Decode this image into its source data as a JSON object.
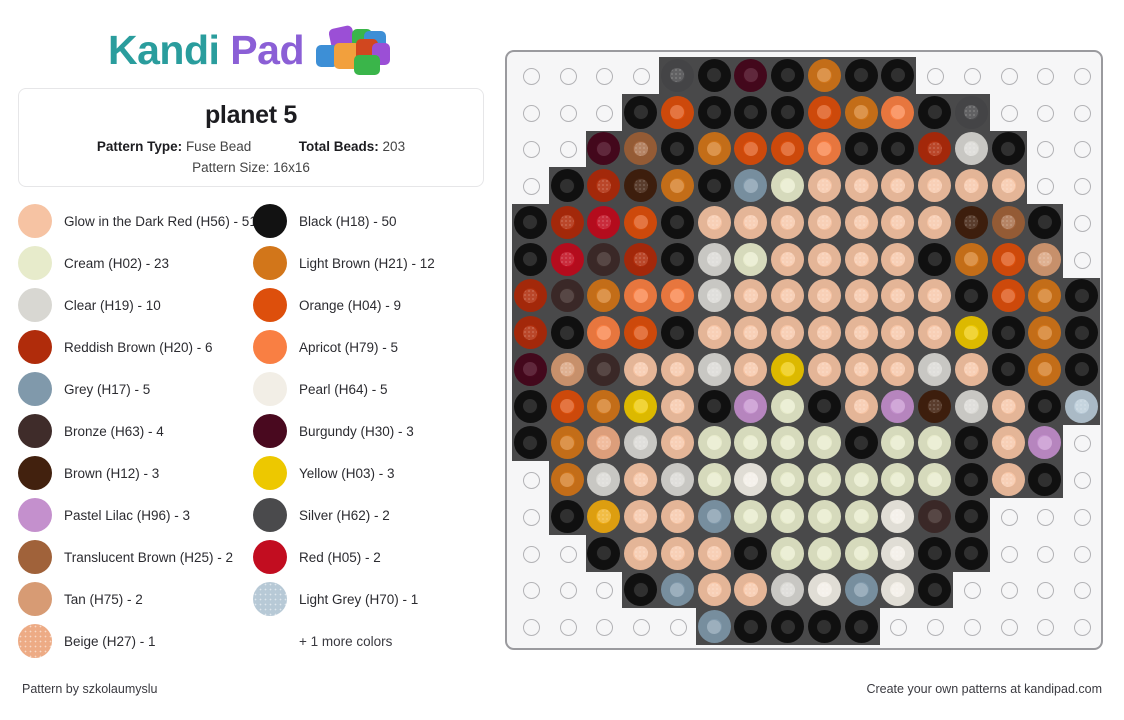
{
  "brand": {
    "name_part1": "Kandi",
    "name_part2": "Pad",
    "logo_icon": "kandi-beads-logo",
    "color_teal": "#2a9d9d",
    "color_purple": "#8b5fd6"
  },
  "info": {
    "title": "planet 5",
    "pattern_type_label": "Pattern Type:",
    "pattern_type_value": "Fuse Bead",
    "total_beads_label": "Total Beads:",
    "total_beads_value": "203",
    "pattern_size_label": "Pattern Size:",
    "pattern_size_value": "16x16"
  },
  "legend": {
    "more_colors": "+ 1 more colors",
    "left_column": [
      {
        "label": "Glow in the Dark Red (H56) - 51",
        "color": "#f6c3a3",
        "name": "Glow in the Dark Red",
        "code": "H56",
        "count": 51,
        "texture": "plain"
      },
      {
        "label": "Cream (H02) - 23",
        "color": "#e7ebcb",
        "name": "Cream",
        "code": "H02",
        "count": 23,
        "texture": "plain"
      },
      {
        "label": "Clear (H19) - 10",
        "color": "#d8d7d2",
        "name": "Clear",
        "code": "H19",
        "count": 10,
        "texture": "plain"
      },
      {
        "label": "Reddish Brown (H20) - 6",
        "color": "#b02c0b",
        "name": "Reddish Brown",
        "code": "H20",
        "count": 6,
        "texture": "plain"
      },
      {
        "label": "Grey (H17) - 5",
        "color": "#8099ab",
        "name": "Grey",
        "code": "H17",
        "count": 5,
        "texture": "plain"
      },
      {
        "label": "Bronze (H63) - 4",
        "color": "#3f2c2a",
        "name": "Bronze",
        "code": "H63",
        "count": 4,
        "texture": "plain"
      },
      {
        "label": "Brown (H12) - 3",
        "color": "#42210e",
        "name": "Brown",
        "code": "H12",
        "count": 3,
        "texture": "plain"
      },
      {
        "label": "Pastel Lilac (H96) - 3",
        "color": "#c490cd",
        "name": "Pastel Lilac",
        "code": "H96",
        "count": 3,
        "texture": "plain"
      },
      {
        "label": "Translucent Brown (H25) - 2",
        "color": "#a0623a",
        "name": "Translucent Brown",
        "code": "H25",
        "count": 2,
        "texture": "plain"
      },
      {
        "label": "Tan (H75) - 2",
        "color": "#d79b74",
        "name": "Tan",
        "code": "H75",
        "count": 2,
        "texture": "plain"
      },
      {
        "label": "Beige (H27) - 1",
        "color": "#edab85",
        "name": "Beige",
        "code": "H27",
        "count": 1,
        "texture": "dotted"
      }
    ],
    "right_column": [
      {
        "label": "Black (H18) - 50",
        "color": "#121212",
        "name": "Black",
        "code": "H18",
        "count": 50,
        "texture": "plain"
      },
      {
        "label": "Light Brown (H21) - 12",
        "color": "#d2761a",
        "name": "Light Brown",
        "code": "H21",
        "count": 12,
        "texture": "plain"
      },
      {
        "label": "Orange (H04) - 9",
        "color": "#dd4f0c",
        "name": "Orange",
        "code": "H04",
        "count": 9,
        "texture": "plain"
      },
      {
        "label": "Apricot (H79) - 5",
        "color": "#f97f43",
        "name": "Apricot",
        "code": "H79",
        "count": 5,
        "texture": "plain"
      },
      {
        "label": "Pearl (H64) - 5",
        "color": "#f2eee6",
        "name": "Pearl",
        "code": "H64",
        "count": 5,
        "texture": "plain"
      },
      {
        "label": "Burgundy (H30) - 3",
        "color": "#49091f",
        "name": "Burgundy",
        "code": "H30",
        "count": 3,
        "texture": "plain"
      },
      {
        "label": "Yellow (H03) - 3",
        "color": "#edc800",
        "name": "Yellow",
        "code": "H03",
        "count": 3,
        "texture": "plain"
      },
      {
        "label": "Silver (H62) - 2",
        "color": "#4a4a4c",
        "name": "Silver",
        "code": "H62",
        "count": 2,
        "texture": "plain"
      },
      {
        "label": "Red (H05) - 2",
        "color": "#c20d20",
        "name": "Red",
        "code": "H05",
        "count": 2,
        "texture": "plain"
      },
      {
        "label": "Light Grey (H70) - 1",
        "color": "#b7c9d6",
        "name": "Light Grey",
        "code": "H70",
        "count": 1,
        "texture": "dotted"
      }
    ]
  },
  "palette": {
    "E": {
      "name": "empty",
      "color": null
    },
    "G": {
      "name": "Glow in the Dark Red",
      "color": "#f6c3a3",
      "texture": "dot",
      "dark": false
    },
    "K": {
      "name": "Black",
      "color": "#121212",
      "texture": "plain",
      "dark": true
    },
    "C": {
      "name": "Cream",
      "color": "#e7ebcb",
      "texture": "plain",
      "dark": false
    },
    "L": {
      "name": "Clear",
      "color": "#d8d7d2",
      "texture": "dot",
      "dark": false
    },
    "R": {
      "name": "Reddish Brown",
      "color": "#b02c0b",
      "texture": "dot",
      "dark": true
    },
    "Y": {
      "name": "Grey",
      "color": "#8099ab",
      "texture": "plain",
      "dark": false
    },
    "Z": {
      "name": "Bronze",
      "color": "#3f2c2a",
      "texture": "plain",
      "dark": true
    },
    "W": {
      "name": "Brown",
      "color": "#42210e",
      "texture": "dot",
      "dark": true
    },
    "P": {
      "name": "Pastel Lilac",
      "color": "#c490cd",
      "texture": "plain",
      "dark": false
    },
    "T": {
      "name": "Translucent Brown",
      "color": "#a0623a",
      "texture": "dot",
      "dark": false
    },
    "N": {
      "name": "Tan",
      "color": "#d79b74",
      "texture": "dot",
      "dark": false
    },
    "B": {
      "name": "Beige",
      "color": "#edab85",
      "texture": "dot",
      "dark": false
    },
    "O": {
      "name": "Light Brown",
      "color": "#d2761a",
      "texture": "plain",
      "dark": false
    },
    "Q": {
      "name": "Orange",
      "color": "#dd4f0c",
      "texture": "plain",
      "dark": false
    },
    "A": {
      "name": "Apricot",
      "color": "#f97f43",
      "texture": "plain",
      "dark": false
    },
    "X": {
      "name": "Pearl",
      "color": "#f2eee6",
      "texture": "dot",
      "dark": false
    },
    "U": {
      "name": "Burgundy",
      "color": "#49091f",
      "texture": "plain",
      "dark": true
    },
    "J": {
      "name": "Yellow",
      "color": "#edc800",
      "texture": "plain",
      "dark": false
    },
    "S": {
      "name": "Silver",
      "color": "#4a4a4c",
      "texture": "dot",
      "dark": true
    },
    "D": {
      "name": "Red",
      "color": "#c20d20",
      "texture": "dot",
      "dark": true
    },
    "H": {
      "name": "Light Grey",
      "color": "#b7c9d6",
      "texture": "dot",
      "dark": false
    },
    "M": {
      "name": "Marigold",
      "color": "#eeab12",
      "texture": "dot",
      "dark": false
    }
  },
  "grid": {
    "rows": 16,
    "cols": 16,
    "cells": [
      [
        "E",
        "E",
        "E",
        "E",
        "S",
        "K",
        "U",
        "K",
        "O",
        "K",
        "K",
        "E",
        "E",
        "E",
        "E",
        "E"
      ],
      [
        "E",
        "E",
        "E",
        "K",
        "Q",
        "K",
        "K",
        "K",
        "Q",
        "O",
        "A",
        "K",
        "S",
        "E",
        "E",
        "E"
      ],
      [
        "E",
        "E",
        "U",
        "T",
        "K",
        "O",
        "Q",
        "Q",
        "A",
        "K",
        "K",
        "R",
        "L",
        "K",
        "E",
        "E"
      ],
      [
        "E",
        "K",
        "R",
        "W",
        "O",
        "K",
        "Y",
        "C",
        "G",
        "G",
        "G",
        "G",
        "G",
        "G",
        "E",
        "E"
      ],
      [
        "K",
        "R",
        "D",
        "Q",
        "K",
        "G",
        "G",
        "G",
        "G",
        "G",
        "G",
        "G",
        "W",
        "T",
        "K",
        "E"
      ],
      [
        "K",
        "D",
        "Z",
        "R",
        "K",
        "L",
        "C",
        "G",
        "G",
        "G",
        "G",
        "K",
        "O",
        "Q",
        "N",
        "E"
      ],
      [
        "R",
        "Z",
        "O",
        "A",
        "A",
        "L",
        "G",
        "G",
        "G",
        "G",
        "G",
        "G",
        "K",
        "Q",
        "O",
        "K"
      ],
      [
        "R",
        "K",
        "A",
        "Q",
        "K",
        "G",
        "G",
        "G",
        "G",
        "G",
        "G",
        "G",
        "J",
        "K",
        "O",
        "K"
      ],
      [
        "U",
        "N",
        "Z",
        "G",
        "G",
        "L",
        "G",
        "J",
        "G",
        "G",
        "G",
        "L",
        "G",
        "K",
        "O",
        "K"
      ],
      [
        "K",
        "Q",
        "O",
        "J",
        "G",
        "K",
        "P",
        "C",
        "K",
        "G",
        "P",
        "W",
        "L",
        "G",
        "K",
        "H"
      ],
      [
        "K",
        "O",
        "B",
        "L",
        "G",
        "C",
        "C",
        "C",
        "C",
        "K",
        "C",
        "C",
        "K",
        "G",
        "P",
        "E"
      ],
      [
        "E",
        "O",
        "L",
        "G",
        "L",
        "C",
        "X",
        "C",
        "C",
        "C",
        "C",
        "C",
        "K",
        "G",
        "K",
        "E"
      ],
      [
        "E",
        "K",
        "M",
        "G",
        "G",
        "Y",
        "C",
        "C",
        "C",
        "C",
        "X",
        "Z",
        "K",
        "E",
        "E",
        "E"
      ],
      [
        "E",
        "E",
        "K",
        "G",
        "G",
        "G",
        "K",
        "C",
        "C",
        "C",
        "X",
        "K",
        "K",
        "E",
        "E",
        "E"
      ],
      [
        "E",
        "E",
        "E",
        "K",
        "Y",
        "G",
        "G",
        "L",
        "X",
        "Y",
        "X",
        "K",
        "E",
        "E",
        "E",
        "E"
      ],
      [
        "E",
        "E",
        "E",
        "E",
        "E",
        "Y",
        "K",
        "K",
        "K",
        "K",
        "E",
        "E",
        "E",
        "E",
        "E",
        "E"
      ]
    ]
  },
  "footer": {
    "left": "Pattern by szkolaumyslu",
    "right": "Create your own patterns at kandipad.com"
  }
}
